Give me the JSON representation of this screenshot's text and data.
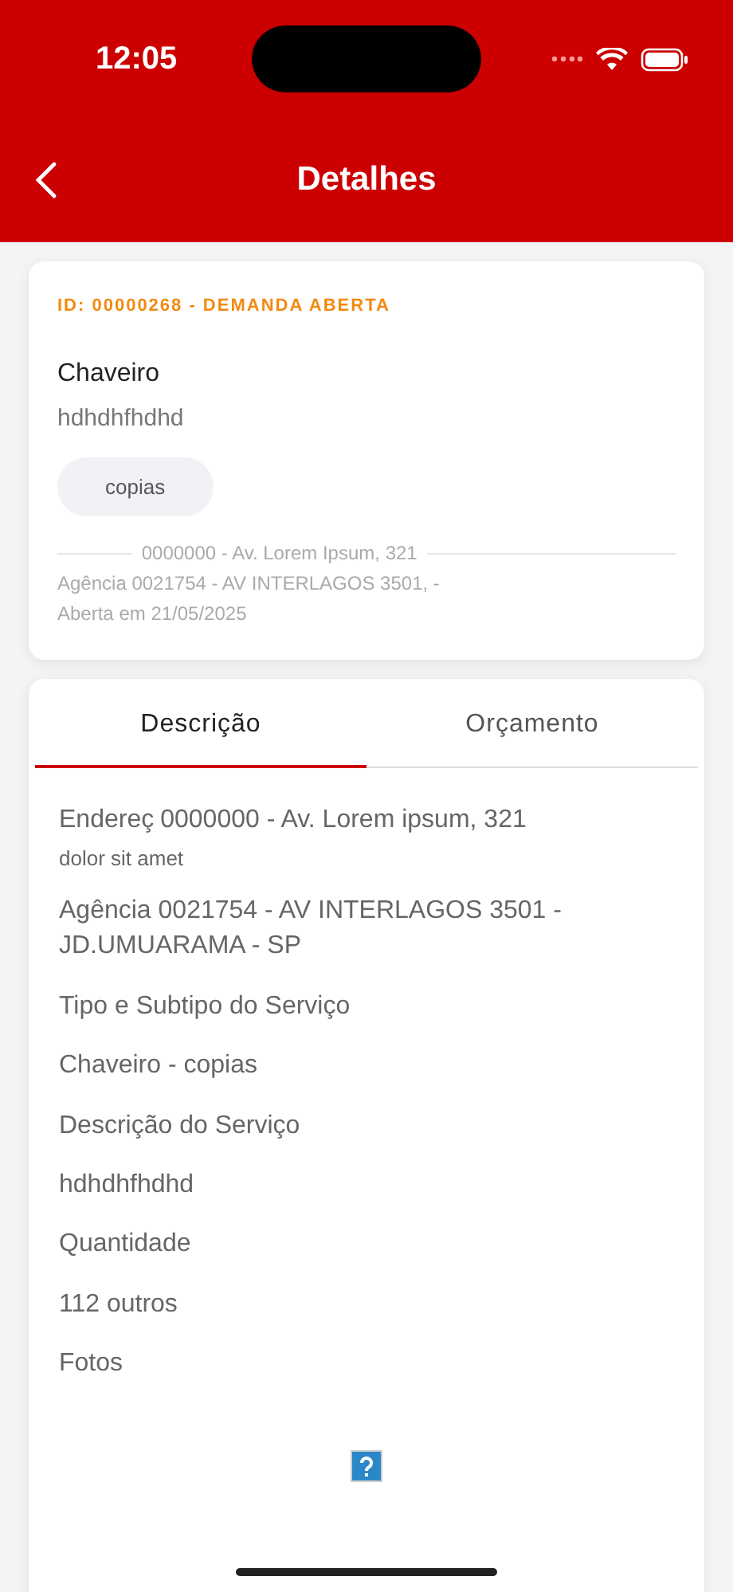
{
  "status_bar": {
    "time": "12:05"
  },
  "header": {
    "title": "Detalhes"
  },
  "summary": {
    "status": "ID: 00000268 - DEMANDA ABERTA",
    "service": "Chaveiro",
    "description": "hdhdhfhdhd",
    "tag": "copias",
    "address": "0000000 - Av. Lorem Ipsum, 321",
    "agency": "Agência 0021754 - AV INTERLAGOS 3501, -",
    "opened": "Aberta em 21/05/2025"
  },
  "tabs": [
    {
      "label": "Descrição",
      "selected": true
    },
    {
      "label": "Orçamento",
      "selected": false
    }
  ],
  "details": {
    "address_label": "Endereç",
    "address_value": "0000000 - Av. Lorem ipsum, 321",
    "address_note": "dolor sit amet",
    "agency": "Agência 0021754 - AV INTERLAGOS 3501 - JD.UMUARAMA - SP",
    "fields": [
      {
        "label": "Tipo e Subtipo do Serviço",
        "value": "Chaveiro - copias"
      },
      {
        "label": "Descrição do Serviço",
        "value": "hdhdhfhdhd"
      },
      {
        "label": "Quantidade",
        "value": "112 outros"
      }
    ],
    "photos_label": "Fotos"
  }
}
